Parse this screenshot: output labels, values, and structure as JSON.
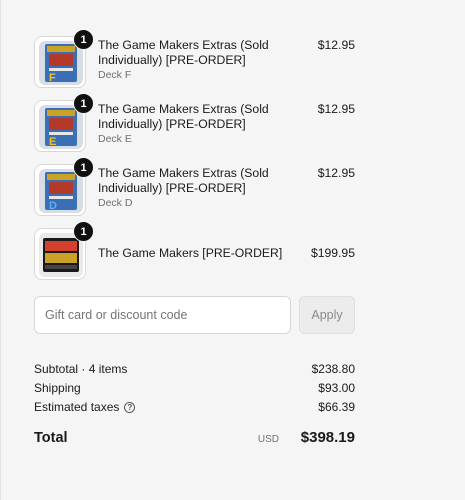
{
  "items": [
    {
      "title": "The Game Makers Extras (Sold Individually) [PRE-ORDER]",
      "variant": "Deck F",
      "price": "$12.95",
      "quantity": "1",
      "thumb": {
        "box": "#3a6fb5",
        "letter": "F",
        "letter_color": "#f2c12e"
      }
    },
    {
      "title": "The Game Makers Extras (Sold Individually) [PRE-ORDER]",
      "variant": "Deck E",
      "price": "$12.95",
      "quantity": "1",
      "thumb": {
        "box": "#3a6fb5",
        "letter": "E",
        "letter_color": "#f2c12e"
      }
    },
    {
      "title": "The Game Makers Extras (Sold Individually) [PRE-ORDER]",
      "variant": "Deck D",
      "price": "$12.95",
      "quantity": "1",
      "thumb": {
        "box": "#3a6fb5",
        "letter": "D",
        "letter_color": "#5ab0ff"
      }
    },
    {
      "title": "The Game Makers [PRE-ORDER]",
      "variant": "",
      "price": "$199.95",
      "quantity": "1",
      "thumb": {
        "box": "#1a1a1a",
        "letter": "",
        "letter_color": "#d4402b"
      }
    }
  ],
  "discount": {
    "placeholder": "Gift card or discount code",
    "apply_label": "Apply"
  },
  "summary": {
    "subtotal_label": "Subtotal · 4 items",
    "subtotal_value": "$238.80",
    "shipping_label": "Shipping",
    "shipping_value": "$93.00",
    "taxes_label": "Estimated taxes",
    "taxes_value": "$66.39",
    "help_icon": "question-circle-icon"
  },
  "total": {
    "label": "Total",
    "currency": "USD",
    "amount": "$398.19"
  }
}
